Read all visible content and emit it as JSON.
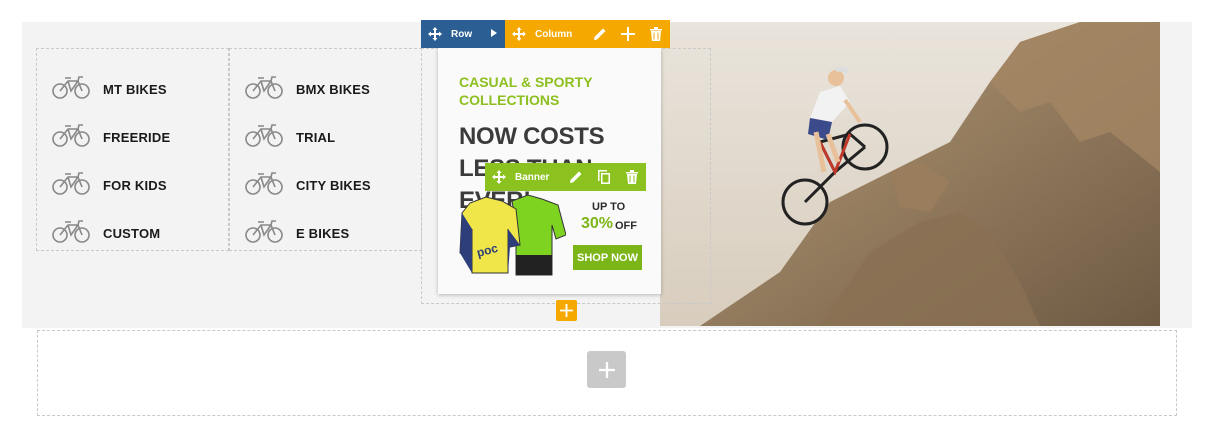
{
  "categories": {
    "column1": [
      {
        "label": "MT BIKES",
        "icon": "mountain-bike-icon"
      },
      {
        "label": "FREERIDE",
        "icon": "freeride-bike-icon"
      },
      {
        "label": "FOR KIDS",
        "icon": "kids-bike-icon"
      },
      {
        "label": "CUSTOM",
        "icon": "custom-bike-icon"
      }
    ],
    "column2": [
      {
        "label": "BMX BIKES",
        "icon": "bmx-bike-icon"
      },
      {
        "label": "TRIAL",
        "icon": "trial-bike-icon"
      },
      {
        "label": "CITY BIKES",
        "icon": "city-bike-icon"
      },
      {
        "label": "E BIKES",
        "icon": "e-bike-icon"
      }
    ]
  },
  "toolbar": {
    "row": {
      "label": "Row",
      "color": "#2b5f93"
    },
    "column": {
      "label": "Column",
      "color": "#f5a800"
    },
    "banner": {
      "label": "Banner",
      "color": "#8cc21f"
    }
  },
  "promo": {
    "subtitle": "CASUAL & SPORTY COLLECTIONS",
    "title": "NOW COSTS LESS THAN EVER!",
    "up_to": "UP TO",
    "percent": "30%",
    "off": "OFF",
    "button": "SHOP NOW"
  },
  "colors": {
    "accent_green": "#7cb518",
    "row_blue": "#2b5f93",
    "column_orange": "#f5a800",
    "placeholder_grey": "#c9c9c9"
  }
}
